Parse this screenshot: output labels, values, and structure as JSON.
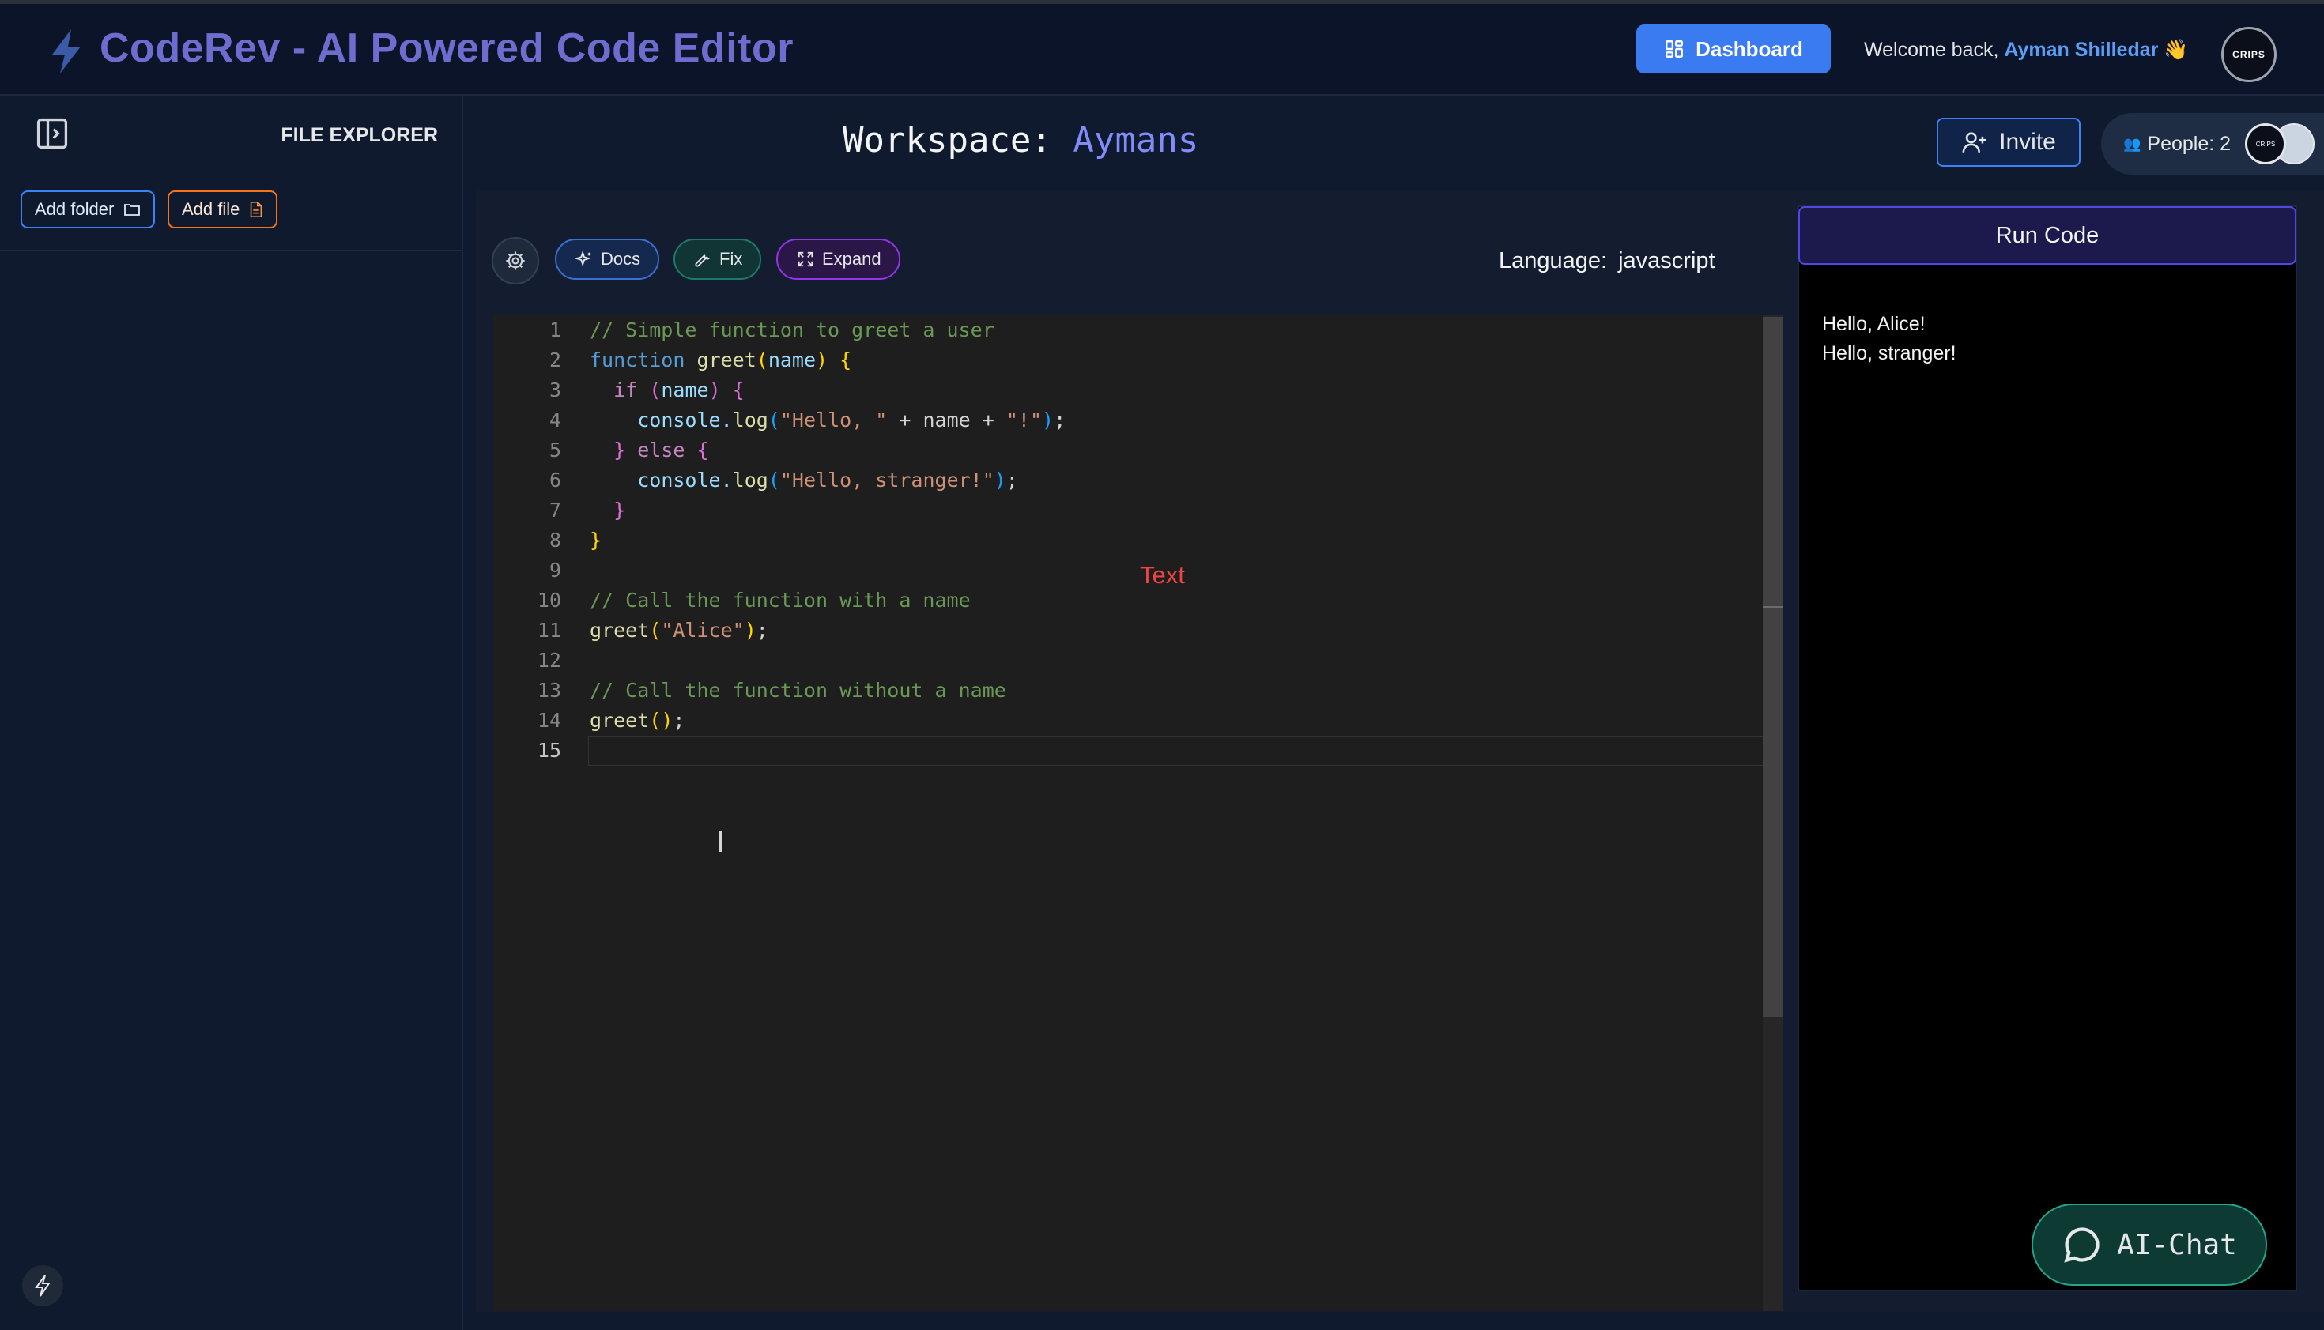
{
  "header": {
    "title": "CodeRev - AI Powered Code Editor",
    "dashboard_label": "Dashboard",
    "welcome_prefix": "Welcome back,",
    "user_name": "Ayman Shilledar",
    "wave": "👋",
    "avatar_text": "CRIPS"
  },
  "sidebar": {
    "title": "FILE EXPLORER",
    "add_folder_label": "Add folder",
    "add_file_label": "Add file"
  },
  "workspace": {
    "label": "Workspace:",
    "name": "Aymans",
    "invite_label": "Invite",
    "people_label": "People: 2"
  },
  "toolbar": {
    "docs_label": "Docs",
    "fix_label": "Fix",
    "expand_label": "Expand",
    "language_label": "Language:",
    "language_value": "javascript"
  },
  "editor": {
    "line_numbers": [
      "1",
      "2",
      "3",
      "4",
      "5",
      "6",
      "7",
      "8",
      "9",
      "10",
      "11",
      "12",
      "13",
      "14",
      "15"
    ],
    "active_line": 15,
    "code": {
      "l1_comment": "// Simple function to greet a user",
      "l2_kw": "function",
      "l2_fn": "greet",
      "l2_param": "name",
      "l3_kw": "if",
      "l3_id": "name",
      "l4_obj": "console.",
      "l4_fn": "log",
      "l4_str1": "\"Hello, \"",
      "l4_mid": " + name + ",
      "l4_str2": "\"!\"",
      "l5_else": "else",
      "l6_obj": "console.",
      "l6_fn": "log",
      "l6_str": "\"Hello, stranger!\"",
      "l10_comment": "// Call the function with a name",
      "l11_fn": "greet",
      "l11_str": "\"Alice\"",
      "l13_comment": "// Call the function without a name",
      "l14_fn": "greet"
    },
    "floating_text": "Text"
  },
  "output": {
    "run_label": "Run Code",
    "lines": [
      "Hello, Alice!",
      "Hello, stranger!"
    ]
  },
  "ai_chat": {
    "label": "AI-Chat"
  },
  "colors": {
    "accent": "#3b7bf1",
    "title": "#6f6ccf",
    "user": "#5b9ef5",
    "workspace_name": "#818cf8",
    "error_text": "#ef4444"
  }
}
